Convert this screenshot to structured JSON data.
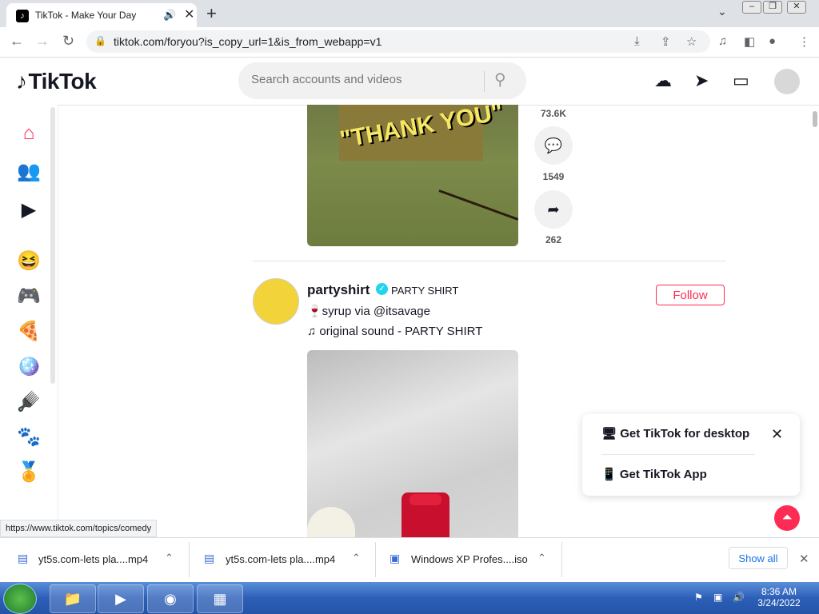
{
  "browser": {
    "tab_title": "TikTok - Make Your Day",
    "url": "tiktok.com/foryou?is_copy_url=1&is_from_webapp=v1",
    "status_link": "https://www.tiktok.com/topics/comedy"
  },
  "header": {
    "logo": "TikTok",
    "search_placeholder": "Search accounts and videos"
  },
  "video1": {
    "caption": "\"THANK YOU\"",
    "likes": "73.6K",
    "comments": "1549",
    "shares": "262"
  },
  "post": {
    "username": "partyshirt",
    "nickname": "PARTY SHIRT",
    "description": "🍷syrup via @itsavage",
    "sound": "original sound - PARTY SHIRT",
    "follow_label": "Follow"
  },
  "popup": {
    "desktop_label": "Get TikTok for desktop",
    "app_label": "Get TikTok App"
  },
  "downloads": {
    "items": [
      "yt5s.com-lets pla....mp4",
      "yt5s.com-lets pla....mp4",
      "Windows XP Profes....iso"
    ],
    "show_all": "Show all"
  },
  "taskbar": {
    "time": "8:36 AM",
    "date": "3/24/2022"
  },
  "colors": {
    "accent": "#fe2c55",
    "verified": "#20d5ec"
  }
}
